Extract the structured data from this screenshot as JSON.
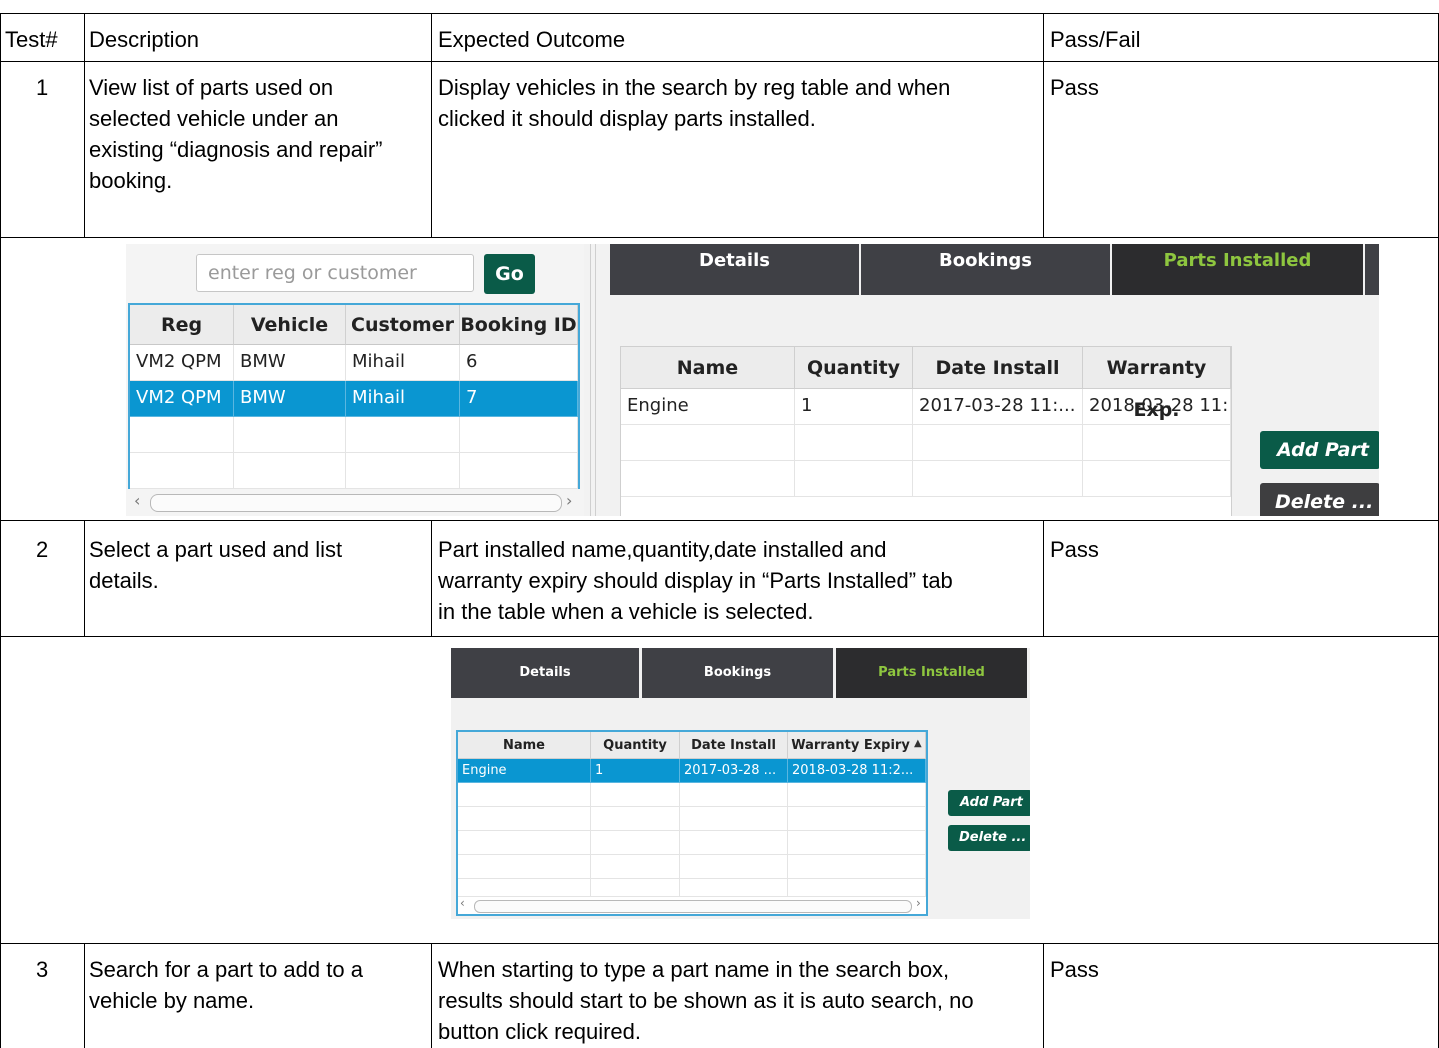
{
  "table": {
    "headers": {
      "test": "Test#",
      "description": "Description",
      "expected": "Expected Outcome",
      "result": "Pass/Fail"
    },
    "rows": [
      {
        "num": "1",
        "desc_lines": [
          "View list of parts used on",
          "selected vehicle under an",
          "existing “diagnosis and repair”",
          "booking."
        ],
        "expected_lines": [
          "Display vehicles in the search by reg table and when",
          "clicked it should display parts installed."
        ],
        "result": "Pass"
      },
      {
        "num": "2",
        "desc_lines": [
          "Select a part used and list",
          "details."
        ],
        "expected_lines": [
          "Part installed name,quantity,date installed and",
          "warranty expiry should display in “Parts Installed” tab",
          "in the table when a vehicle is selected."
        ],
        "result": "Pass"
      },
      {
        "num": "3",
        "desc_lines": [
          "Search for a part to add to a",
          "vehicle by name."
        ],
        "expected_lines": [
          "When starting to type a part name in the search box,",
          "results should start to be shown as it is auto search, no",
          "button click required."
        ],
        "result": "Pass"
      }
    ]
  },
  "screenshot1": {
    "search_placeholder": "enter reg or customer name",
    "go_label": "Go",
    "vehicle_columns": [
      "Reg",
      "Vehicle",
      "Customer",
      "Booking ID"
    ],
    "vehicle_rows": [
      [
        "VM2 QPM",
        "BMW",
        "Mihail",
        "6"
      ],
      [
        "VM2 QPM",
        "BMW",
        "Mihail",
        "7"
      ]
    ],
    "tabs": [
      "Details",
      "Bookings",
      "Parts Installed"
    ],
    "parts_columns": [
      "Name",
      "Quantity",
      "Date Install",
      "Warranty Exp."
    ],
    "parts_rows": [
      [
        "Engine",
        "1",
        "2017-03-28 11:...",
        "2018-03-28 11:."
      ]
    ],
    "add_part": "Add Part",
    "delete": "Delete ..."
  },
  "screenshot2": {
    "tabs": [
      "Details",
      "Bookings",
      "Parts Installed"
    ],
    "parts_columns": [
      "Name",
      "Quantity",
      "Date Install",
      "Warranty Expiry"
    ],
    "sort_arrow": "▲",
    "parts_rows": [
      [
        "Engine",
        "1",
        "2017-03-28 ...",
        "2018-03-28 11:2..."
      ]
    ],
    "add_part": "Add Part",
    "delete": "Delete ..."
  },
  "colors": {
    "selection": "#0a96d1",
    "button_green": "#0a5b48",
    "tab_dark": "#3f4045",
    "active_tab_text": "#8ec63f",
    "table_focus_border": "#45a8d8"
  }
}
